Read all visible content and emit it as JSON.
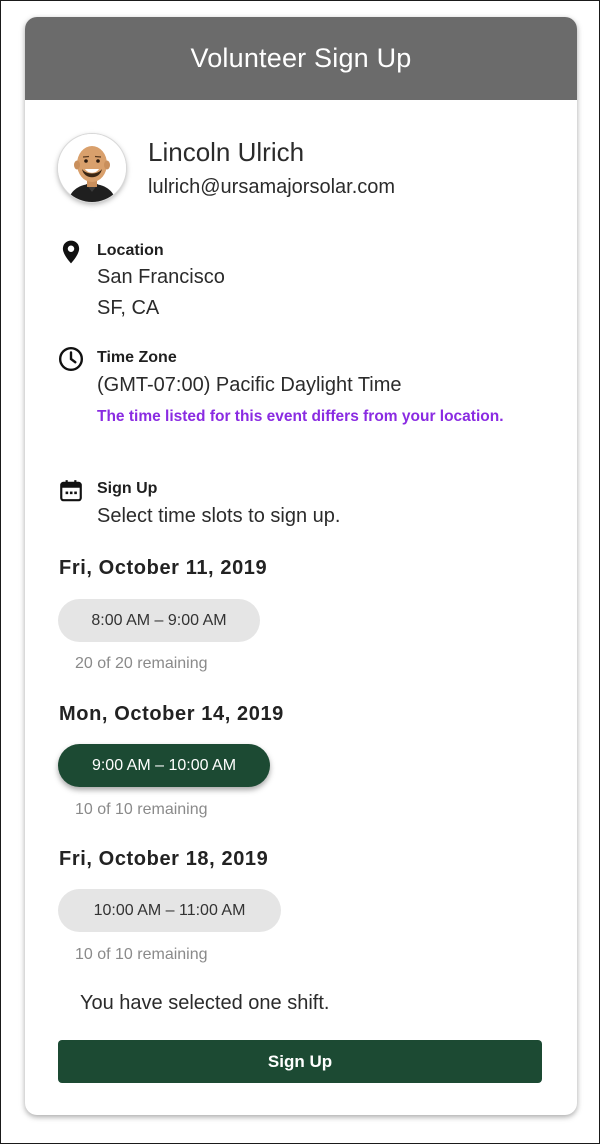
{
  "header": {
    "title": "Volunteer Sign Up"
  },
  "user": {
    "name": "Lincoln Ulrich",
    "email": "lulrich@ursamajorsolar.com",
    "avatar_icon": "avatar-illustration"
  },
  "location": {
    "icon": "map-pin-icon",
    "label": "Location",
    "line1": "San Francisco",
    "line2": "SF, CA"
  },
  "time_zone": {
    "icon": "clock-icon",
    "label": "Time Zone",
    "value": "(GMT-07:00) Pacific Daylight Time",
    "note": "The time listed for this event differs from your location."
  },
  "sign_up_section": {
    "icon": "calendar-icon",
    "label": "Sign Up",
    "instructions": "Select time slots to sign up."
  },
  "days": [
    {
      "date": "Fri, October 11, 2019",
      "slot": "8:00 AM – 9:00 AM",
      "remaining": "20 of 20 remaining",
      "selected": false
    },
    {
      "date": "Mon, October 14, 2019",
      "slot": "9:00 AM – 10:00 AM",
      "remaining": "10 of 10 remaining",
      "selected": true
    },
    {
      "date": "Fri, October 18, 2019",
      "slot": "10:00 AM – 11:00 AM",
      "remaining": "10 of 10 remaining",
      "selected": false
    }
  ],
  "summary": {
    "text": "You have selected one shift."
  },
  "actions": {
    "sign_up_label": "Sign Up"
  },
  "colors": {
    "header_bg": "#6b6b6b",
    "primary_green": "#1c4a33",
    "slot_bg": "#e5e5e5",
    "note_purple": "#8a2be2",
    "muted_text": "#8a8a8a"
  }
}
